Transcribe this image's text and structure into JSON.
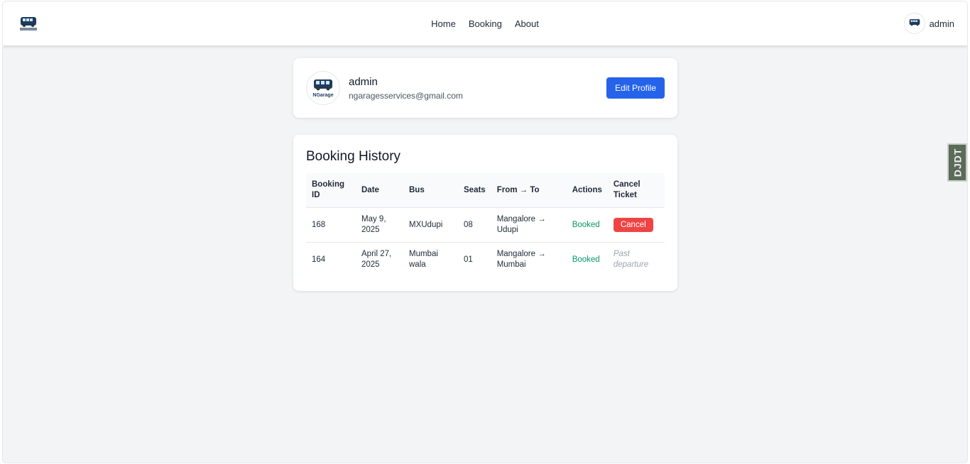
{
  "nav": {
    "brand_logo_text": "NGarage",
    "links": [
      "Home",
      "Booking",
      "About"
    ],
    "user_name": "admin"
  },
  "profile": {
    "name": "admin",
    "email": "ngaragesservices@gmail.com",
    "edit_label": "Edit Profile",
    "avatar_logo_text": "NGarage"
  },
  "history": {
    "title": "Booking History",
    "columns": [
      "Booking ID",
      "Date",
      "Bus",
      "Seats",
      "From → To",
      "Actions",
      "Cancel Ticket"
    ],
    "rows": [
      {
        "id": "168",
        "date": "May 9, 2025",
        "bus": "MXUdupi",
        "seats": "08",
        "route": "Mangalore → Udupi",
        "status": "Booked",
        "cancel": "Cancel"
      },
      {
        "id": "164",
        "date": "April 27, 2025",
        "bus": "Mumbai wala",
        "seats": "01",
        "route": "Mangalore → Mumbai",
        "status": "Booked",
        "cancel": "Past departure"
      }
    ]
  },
  "side_tab": {
    "label": "DJDT"
  },
  "colors": {
    "primary": "#2563eb",
    "danger": "#ef4444",
    "success": "#059669",
    "background": "#f3f4f6"
  }
}
